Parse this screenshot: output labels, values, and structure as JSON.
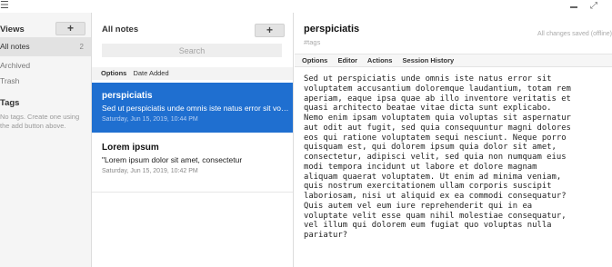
{
  "window": {
    "menu_icon": "hamburger-icon",
    "minimize_icon": "minimize-icon",
    "maximize_icon": "fullscreen-icon"
  },
  "views": {
    "title": "Views",
    "add_label": "+",
    "items": [
      {
        "label": "All notes",
        "count": "2"
      },
      {
        "label": "Archived",
        "count": ""
      },
      {
        "label": "Trash",
        "count": ""
      }
    ],
    "tags_title": "Tags",
    "tags_help": "No tags. Create one using the add button above."
  },
  "notes": {
    "title": "All notes",
    "add_label": "+",
    "search_placeholder": "Search",
    "sort_options": "Options",
    "sort_by": "Date Added",
    "items": [
      {
        "title": "perspiciatis",
        "snippet": "Sed ut perspiciatis unde omnis iste natus error sit voluptatem",
        "date": "Saturday, Jun 15, 2019, 10:44 PM"
      },
      {
        "title": "Lorem ipsum",
        "snippet": "\"Lorem ipsum dolor sit amet, consectetur",
        "date": "Saturday, Jun 15, 2019, 10:42 PM"
      }
    ]
  },
  "editor": {
    "title": "perspiciatis",
    "tags_placeholder": "#tags",
    "save_status": "All changes saved (offline)",
    "tabs": [
      "Options",
      "Editor",
      "Actions",
      "Session History"
    ],
    "body": "Sed ut perspiciatis unde omnis iste natus error sit\nvoluptatem accusantium doloremque laudantium, totam rem\naperiam, eaque ipsa quae ab illo inventore veritatis et\nquasi architecto beatae vitae dicta sunt explicabo.\nNemo enim ipsam voluptatem quia voluptas sit aspernatur\naut odit aut fugit, sed quia consequuntur magni dolores\neos qui ratione voluptatem sequi nesciunt. Neque porro\nquisquam est, qui dolorem ipsum quia dolor sit amet,\nconsectetur, adipisci velit, sed quia non numquam eius\nmodi tempora incidunt ut labore et dolore magnam\naliquam quaerat voluptatem. Ut enim ad minima veniam,\nquis nostrum exercitationem ullam corporis suscipit\nlaboriosam, nisi ut aliquid ex ea commodi consequatur?\nQuis autem vel eum iure reprehenderit qui in ea\nvoluptate velit esse quam nihil molestiae consequatur,\nvel illum qui dolorem eum fugiat quo voluptas nulla\npariatur?",
    "accent_color": "#1f6fd0"
  }
}
